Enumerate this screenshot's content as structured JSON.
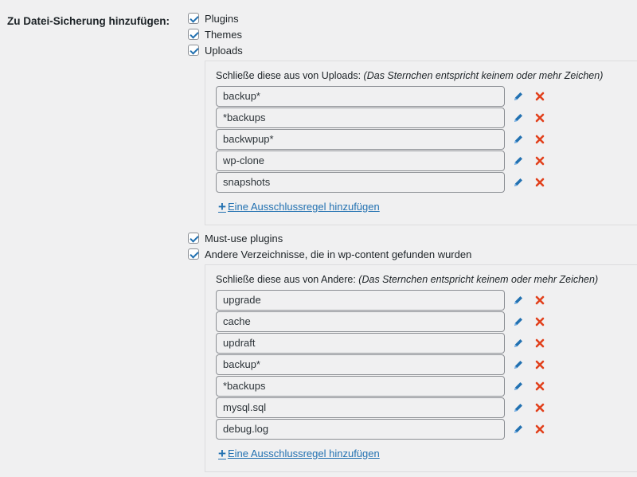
{
  "section_label": "Zu Datei-Sicherung hinzufügen:",
  "options": [
    {
      "label": "Plugins",
      "checked": true
    },
    {
      "label": "Themes",
      "checked": true
    },
    {
      "label": "Uploads",
      "checked": true
    },
    {
      "label": "Must-use plugins",
      "checked": true
    },
    {
      "label": "Andere Verzeichnisse, die in wp-content gefunden wurden",
      "checked": true
    }
  ],
  "uploads_exclusions": {
    "heading": "Schließe diese aus von Uploads:",
    "hint": "(Das Sternchen entspricht keinem oder mehr Zeichen)",
    "rules": [
      "backup*",
      "*backups",
      "backwpup*",
      "wp-clone",
      "snapshots"
    ],
    "add_label": "Eine Ausschlussregel hinzufügen"
  },
  "other_exclusions": {
    "heading": "Schließe diese aus von Andere:",
    "hint": "(Das Sternchen entspricht keinem oder mehr Zeichen)",
    "rules": [
      "upgrade",
      "cache",
      "updraft",
      "backup*",
      "*backups",
      "mysql.sql",
      "debug.log"
    ],
    "add_label": "Eine Ausschlussregel hinzufügen"
  },
  "icons": {
    "edit": "pencil-icon",
    "delete": "cross-icon",
    "add": "plus-icon"
  },
  "colors": {
    "accent": "#2271b1",
    "delete": "#e2401c"
  }
}
